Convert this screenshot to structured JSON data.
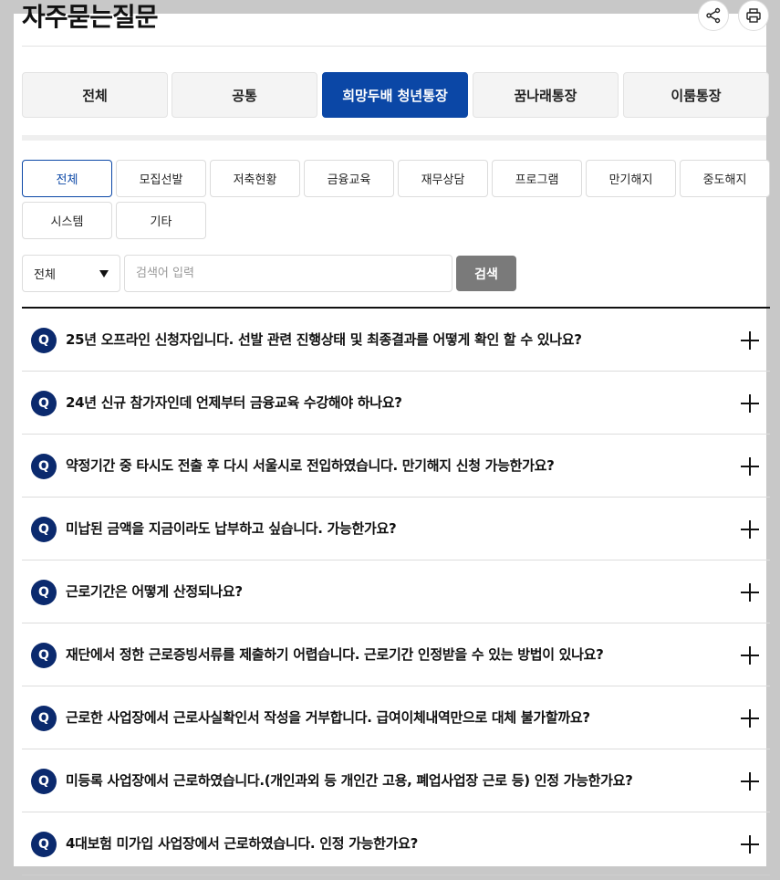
{
  "page": {
    "title": "자주묻는질문"
  },
  "header_actions": {
    "share_icon": "share-icon",
    "print_icon": "print-icon"
  },
  "tabs": [
    {
      "label": "전체",
      "active": false
    },
    {
      "label": "공통",
      "active": false
    },
    {
      "label": "희망두배 청년통장",
      "active": true
    },
    {
      "label": "꿈나래통장",
      "active": false
    },
    {
      "label": "이룸통장",
      "active": false
    }
  ],
  "categories": [
    {
      "label": "전체",
      "active": true
    },
    {
      "label": "모집선발",
      "active": false
    },
    {
      "label": "저축현황",
      "active": false
    },
    {
      "label": "금융교육",
      "active": false
    },
    {
      "label": "재무상담",
      "active": false
    },
    {
      "label": "프로그램",
      "active": false
    },
    {
      "label": "만기해지",
      "active": false
    },
    {
      "label": "중도해지",
      "active": false
    },
    {
      "label": "시스템",
      "active": false
    },
    {
      "label": "기타",
      "active": false
    }
  ],
  "search": {
    "select_value": "전체",
    "placeholder": "검색어 입력",
    "button_label": "검색"
  },
  "faq": {
    "badge": "Q",
    "items": [
      "25년 오프라인 신청자입니다. 선발 관련 진행상태 및 최종결과를 어떻게 확인 할 수 있나요?",
      "24년 신규 참가자인데 언제부터 금융교육 수강해야 하나요?",
      "약정기간 중 타시도 전출 후 다시 서울시로 전입하였습니다. 만기해지 신청 가능한가요?",
      "미납된 금액을 지금이라도 납부하고 싶습니다. 가능한가요?",
      "근로기간은 어떻게 산정되나요?",
      "재단에서 정한 근로증빙서류를 제출하기 어렵습니다. 근로기간 인정받을 수 있는 방법이 있나요?",
      "근로한 사업장에서 근로사실확인서 작성을 거부합니다. 급여이체내역만으로 대체 불가할까요?",
      "미등록 사업장에서 근로하였습니다.(개인과외 등 개인간 고용, 폐업사업장 근로 등) 인정 가능한가요?",
      "4대보험 미가입 사업장에서 근로하였습니다. 인정 가능한가요?"
    ]
  },
  "colors": {
    "accent": "#0b47a6",
    "badge": "#0b2a6e",
    "search_button": "#7a7a7a"
  }
}
